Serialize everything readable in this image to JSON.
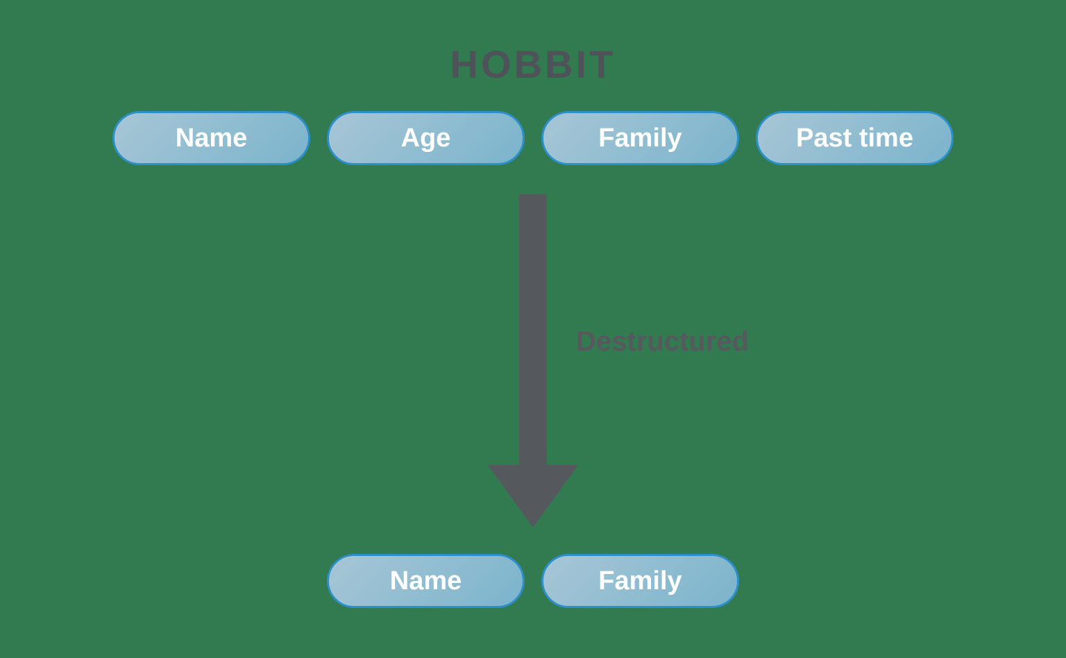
{
  "title": "HOBBIT",
  "top_row": {
    "items": [
      "Name",
      "Age",
      "Family",
      "Past time"
    ]
  },
  "arrow_label": "Destructured",
  "bottom_row": {
    "items": [
      "Name",
      "Family"
    ]
  },
  "colors": {
    "background": "#327a4f",
    "pill_border": "#2c8fc9",
    "pill_fill_start": "#a7c6d6",
    "pill_fill_end": "#7bb4cc",
    "pill_text": "#ffffff",
    "title_text": "#4e5359",
    "arrow": "#55595e",
    "label_text": "#565a5f"
  }
}
